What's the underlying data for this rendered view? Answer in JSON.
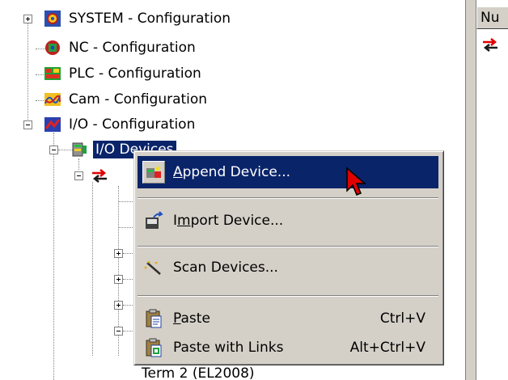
{
  "tree": {
    "items": [
      {
        "label": "SYSTEM - Configuration",
        "icon": "system-config-icon"
      },
      {
        "label": "NC - Configuration",
        "icon": "nc-config-icon"
      },
      {
        "label": "PLC - Configuration",
        "icon": "plc-config-icon"
      },
      {
        "label": "Cam - Configuration",
        "icon": "cam-config-icon"
      },
      {
        "label": "I/O - Configuration",
        "icon": "io-config-icon"
      },
      {
        "label": "I/O Devices",
        "icon": "io-devices-icon",
        "selected": true
      }
    ],
    "partial_label": "Term 2 (EL2008)"
  },
  "right_pane": {
    "column_header": "Nu"
  },
  "context_menu": {
    "items": [
      {
        "pre": "",
        "key": "A",
        "post": "ppend Device...",
        "shortcut": "",
        "icon": "append-device-icon",
        "highlighted": true
      },
      {
        "pre": "I",
        "key": "m",
        "post": "port Device...",
        "shortcut": "",
        "icon": "import-device-icon"
      },
      {
        "pre": "Scan Devices...",
        "key": "",
        "post": "",
        "shortcut": "",
        "icon": "scan-devices-icon"
      },
      {
        "pre": "",
        "key": "P",
        "post": "aste",
        "shortcut": "Ctrl+V",
        "icon": "paste-icon"
      },
      {
        "pre": "Paste with Links",
        "key": "",
        "post": "",
        "shortcut": "Alt+Ctrl+V",
        "icon": "paste-links-icon"
      }
    ]
  },
  "colors": {
    "selection": "#0a246a",
    "menu_bg": "#d4d0c8",
    "accent_red": "#e00000"
  }
}
